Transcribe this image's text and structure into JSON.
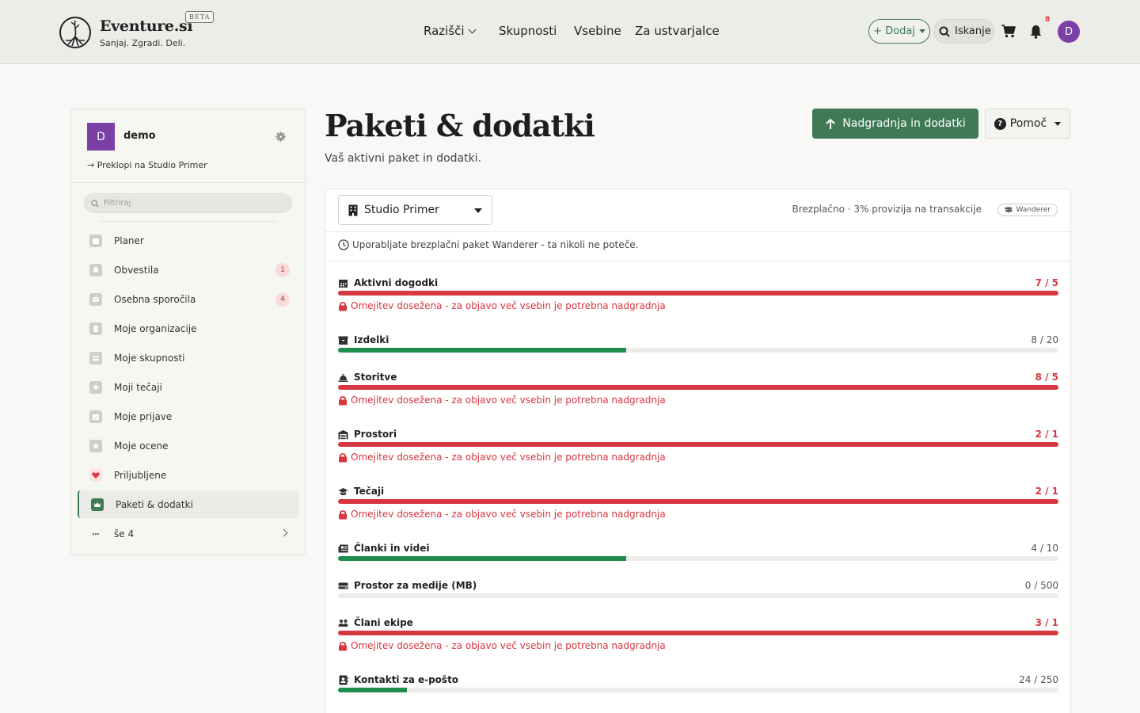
{
  "header": {
    "brand": "Eventure.si",
    "beta": "BETA",
    "tagline": "Sanjaj. Zgradi. Deli.",
    "nav": [
      "Razišči",
      "Skupnosti",
      "Vsebine",
      "Za ustvarjalce"
    ],
    "add_label": "+ Dodaj",
    "search_label": "Iskanje",
    "notifications_count": "8",
    "user_initial": "D"
  },
  "sidebar": {
    "org_initial": "D",
    "org_name": "demo",
    "switch_label": "Preklopi na Studio Primer",
    "filter_placeholder": "Filtriraj",
    "items": [
      {
        "label": "Planer",
        "icon": "calendar-icon"
      },
      {
        "label": "Obvestila",
        "icon": "bell-icon",
        "badge": "1"
      },
      {
        "label": "Osebna sporočila",
        "icon": "envelope-icon",
        "badge": "4"
      },
      {
        "label": "Moje organizacije",
        "icon": "building-icon"
      },
      {
        "label": "Moje skupnosti",
        "icon": "users-icon"
      },
      {
        "label": "Moji tečaji",
        "icon": "graduation-cap-icon"
      },
      {
        "label": "Moje prijave",
        "icon": "calendar-check-icon"
      },
      {
        "label": "Moje ocene",
        "icon": "star-icon"
      },
      {
        "label": "Priljubljene",
        "icon": "heart-icon"
      },
      {
        "label": "Paketi & dodatki",
        "icon": "crown-icon",
        "active": true
      },
      {
        "label": "še 4",
        "icon": "ellipsis-icon"
      }
    ]
  },
  "main": {
    "title": "Paketi & dodatki",
    "subtitle": "Vaš aktivni paket in dodatki.",
    "upgrade_label": "Nadgradnja in dodatki",
    "help_label": "Pomoč"
  },
  "card": {
    "org_select": "Studio Primer",
    "plan_info": "Brezplačno · 3% provizija na transakcije",
    "plan_badge": "Wanderer",
    "notice": "Uporabljate brezplačni paket Wanderer - ta nikoli ne poteče.",
    "limit_warning": "Omejitev dosežena - za objavo več vsebin je potrebna nadgradnja",
    "usage": [
      {
        "label": "Aktivni dogodki",
        "value": "7 / 5",
        "used": 7,
        "limit": 5,
        "over": true,
        "icon": "calendar-icon"
      },
      {
        "label": "Izdelki",
        "value": "8 / 20",
        "used": 8,
        "limit": 20,
        "over": false,
        "icon": "box-icon"
      },
      {
        "label": "Storitve",
        "value": "8 / 5",
        "used": 8,
        "limit": 5,
        "over": true,
        "icon": "service-bell-icon"
      },
      {
        "label": "Prostori",
        "value": "2 / 1",
        "used": 2,
        "limit": 1,
        "over": true,
        "icon": "warehouse-icon"
      },
      {
        "label": "Tečaji",
        "value": "2 / 1",
        "used": 2,
        "limit": 1,
        "over": true,
        "icon": "graduation-cap-icon"
      },
      {
        "label": "Članki in videi",
        "value": "4 / 10",
        "used": 4,
        "limit": 10,
        "over": false,
        "icon": "newspaper-icon"
      },
      {
        "label": "Prostor za medije (MB)",
        "value": "0 / 500",
        "used": 0,
        "limit": 500,
        "over": false,
        "icon": "hard-drive-icon"
      },
      {
        "label": "Člani ekipe",
        "value": "3 / 1",
        "used": 3,
        "limit": 1,
        "over": true,
        "icon": "users-icon"
      },
      {
        "label": "Kontakti za e-pošto",
        "value": "24 / 250",
        "used": 24,
        "limit": 250,
        "over": false,
        "icon": "address-book-icon"
      }
    ]
  }
}
